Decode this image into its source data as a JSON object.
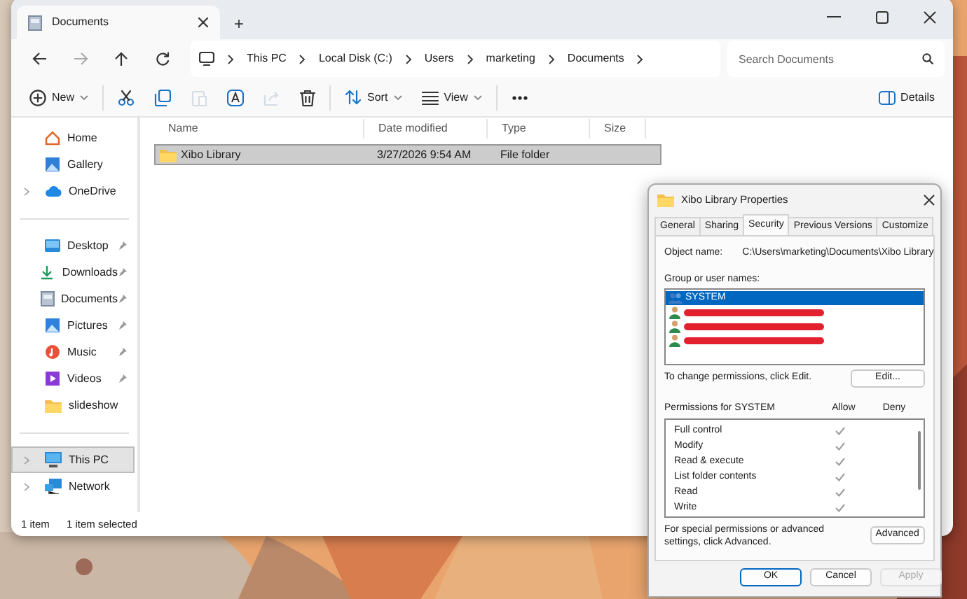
{
  "explorer": {
    "tab_title": "Documents",
    "new_tab": "+",
    "breadcrumb": [
      "This PC",
      "Local Disk (C:)",
      "Users",
      "marketing",
      "Documents"
    ],
    "search": {
      "placeholder": "Search Documents"
    },
    "commands": [
      {
        "kind": "new",
        "label": "New",
        "disabled": false
      },
      {
        "kind": "cut",
        "disabled": false
      },
      {
        "kind": "copy",
        "disabled": false
      },
      {
        "kind": "paste",
        "disabled": true
      },
      {
        "kind": "rename",
        "disabled": false
      },
      {
        "kind": "share",
        "disabled": true
      },
      {
        "kind": "delete",
        "disabled": false
      },
      {
        "kind": "sort",
        "label": "Sort",
        "disabled": false
      },
      {
        "kind": "view",
        "label": "View",
        "disabled": false
      },
      {
        "kind": "more",
        "disabled": false
      }
    ],
    "details_label": "Details",
    "sidebar": [
      [
        {
          "kind": "home",
          "label": "Home",
          "pinned": false,
          "expandable": false,
          "selected": false
        },
        {
          "kind": "gallery",
          "label": "Gallery",
          "pinned": false,
          "expandable": false,
          "selected": false
        },
        {
          "kind": "cloud",
          "label": "OneDrive",
          "pinned": false,
          "expandable": true,
          "selected": false
        }
      ],
      [
        {
          "kind": "desktop",
          "label": "Desktop",
          "pinned": true,
          "expandable": false,
          "selected": false
        },
        {
          "kind": "download",
          "label": "Downloads",
          "pinned": true,
          "expandable": false,
          "selected": false
        },
        {
          "kind": "documents",
          "label": "Documents",
          "pinned": true,
          "expandable": false,
          "selected": false
        },
        {
          "kind": "pictures",
          "label": "Pictures",
          "pinned": true,
          "expandable": false,
          "selected": false
        },
        {
          "kind": "music",
          "label": "Music",
          "pinned": true,
          "expandable": false,
          "selected": false
        },
        {
          "kind": "videos",
          "label": "Videos",
          "pinned": true,
          "expandable": false,
          "selected": false
        },
        {
          "kind": "folder",
          "label": "slideshow",
          "pinned": false,
          "expandable": false,
          "selected": false
        }
      ],
      [
        {
          "kind": "pc",
          "label": "This PC",
          "pinned": false,
          "expandable": true,
          "selected": true
        },
        {
          "kind": "network",
          "label": "Network",
          "pinned": false,
          "expandable": true,
          "selected": false
        }
      ]
    ],
    "columns": [
      "Name",
      "Date modified",
      "Type",
      "Size"
    ],
    "rows": [
      {
        "name": "Xibo Library",
        "date": "3/27/2026 9:54 AM",
        "type": "File folder",
        "selected": true
      }
    ],
    "status": [
      "1 item",
      "1 item selected"
    ]
  },
  "dialog": {
    "title": "Xibo Library Properties",
    "tabs": [
      {
        "label": "General",
        "selected": false
      },
      {
        "label": "Sharing",
        "selected": false
      },
      {
        "label": "Security",
        "selected": true
      },
      {
        "label": "Previous Versions",
        "selected": false
      },
      {
        "label": "Customize",
        "selected": false
      }
    ],
    "object_label": "Object name:",
    "object_value": "C:\\Users\\marketing\\Documents\\Xibo Library",
    "group_label": "Group or user names:",
    "principals": [
      {
        "kind": "group",
        "name": "SYSTEM",
        "selected": true
      },
      {
        "kind": "redacted",
        "selected": false
      },
      {
        "kind": "redacted",
        "selected": false
      },
      {
        "kind": "redacted",
        "selected": false
      }
    ],
    "change_hint": "To change permissions, click Edit.",
    "edit_button": "Edit...",
    "permissions_title": "Permissions for SYSTEM",
    "allow_label": "Allow",
    "deny_label": "Deny",
    "permissions": [
      {
        "name": "Full control",
        "allow": true,
        "deny": false
      },
      {
        "name": "Modify",
        "allow": true,
        "deny": false
      },
      {
        "name": "Read & execute",
        "allow": true,
        "deny": false
      },
      {
        "name": "List folder contents",
        "allow": true,
        "deny": false
      },
      {
        "name": "Read",
        "allow": true,
        "deny": false
      },
      {
        "name": "Write",
        "allow": true,
        "deny": false
      }
    ],
    "advanced_hint": "For special permissions or advanced settings, click Advanced.",
    "advanced_button": "Advanced",
    "buttons": [
      {
        "label": "OK",
        "default": true,
        "disabled": false
      },
      {
        "label": "Cancel",
        "default": false,
        "disabled": false
      },
      {
        "label": "Apply",
        "default": false,
        "disabled": true
      }
    ]
  }
}
